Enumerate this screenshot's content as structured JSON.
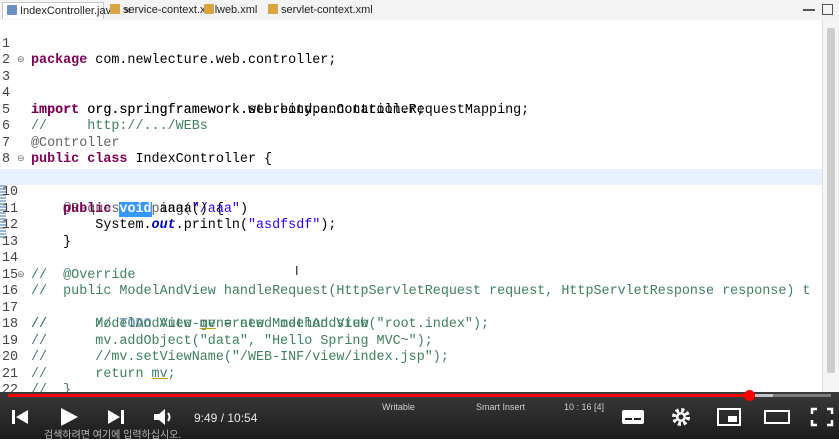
{
  "tabs": [
    {
      "label": "IndexController.java",
      "icon": "java-file-icon",
      "active": true
    },
    {
      "label": "service-context.xml",
      "icon": "xml-file-icon",
      "active": false
    },
    {
      "label": "web.xml",
      "icon": "xml-file-icon",
      "active": false
    },
    {
      "label": "servlet-context.xml",
      "icon": "xml-file-icon",
      "active": false
    }
  ],
  "editor": {
    "current_line": 10,
    "lines": [
      {
        "n": "1",
        "fold": ""
      },
      {
        "n": "2",
        "fold": ""
      },
      {
        "n": "3",
        "fold": "⊖"
      },
      {
        "n": "4",
        "fold": ""
      },
      {
        "n": "5",
        "fold": ""
      },
      {
        "n": "6",
        "fold": ""
      },
      {
        "n": "7",
        "fold": ""
      },
      {
        "n": "8",
        "fold": ""
      },
      {
        "n": "9",
        "fold": "⊖"
      },
      {
        "n": "10",
        "fold": ""
      },
      {
        "n": "11",
        "fold": ""
      },
      {
        "n": "12",
        "fold": ""
      },
      {
        "n": "13",
        "fold": ""
      },
      {
        "n": "14",
        "fold": ""
      },
      {
        "n": "15",
        "fold": ""
      },
      {
        "n": "16",
        "fold": "⊖"
      },
      {
        "n": "17",
        "fold": ""
      },
      {
        "n": "18",
        "fold": ""
      },
      {
        "n": "19",
        "fold": ""
      },
      {
        "n": "20",
        "fold": ""
      },
      {
        "n": "21",
        "fold": ""
      },
      {
        "n": "22",
        "fold": ""
      },
      {
        "n": "23",
        "fold": ""
      }
    ],
    "tokens": {
      "l1_kw": "package",
      "l1_rest": " com.newlecture.web.controller;",
      "l3_kw": "import",
      "l3_rest": " org.springframework.stereotype.Controller;",
      "l4_kw": "import",
      "l4_rest": " org.springframework.web.bind.annotation.RequestMapping;",
      "l5_cm": "//     http://.../WEBs",
      "l6_ann": "@Controller",
      "l7_kw": "public class",
      "l7_rest": " IndexController {",
      "l9_ann": "    @RequestMapping(",
      "l9_str": "\"/aaa\"",
      "l9_rest": ")",
      "l10_kw": "    public ",
      "l10_sel": "void",
      "l10_rest": " aaaa() {",
      "l11_a": "        System.",
      "l11_it": "out",
      "l11_b": ".println(",
      "l11_str": "\"asdfsdf\"",
      "l11_c": ");",
      "l12_rest": "    }",
      "l14_cm": "//  @Override",
      "l15_cm": "//  public ModelAndView handleRequest(HttpServletRequest request, HttpServletResponse response) t",
      "l16_cm1": "//      // ",
      "l16_todo": "TODO",
      "l16_cm2": " Auto-generated method stub",
      "l17_cm1": "//      ModelAndView ",
      "l17_ul": "mv",
      "l17_cm2": " = new ModelAndView(\"root.index\");",
      "l18_cm": "//      mv.addObject(\"data\", \"Hello Spring MVC~\");",
      "l19_cm": "//      //mv.setViewName(\"/WEB-INF/view/index.jsp\");",
      "l20_cm1": "//      return ",
      "l20_ul": "mv",
      "l20_cm2": ";",
      "l21_cm": "//  }",
      "l23_rest": "}"
    }
  },
  "status": {
    "writable": "Writable",
    "insert_mode": "Smart Insert",
    "position": "10 : 16 [4]"
  },
  "player": {
    "time_current": "9:49",
    "time_separator": " / ",
    "time_total": "10:54",
    "progress_fraction": 0.9,
    "buffer_fraction": 0.93,
    "accent_color": "#ff0000"
  },
  "taskbar": {
    "search_hint": "검색하려면 여기에 입력하십시오."
  }
}
